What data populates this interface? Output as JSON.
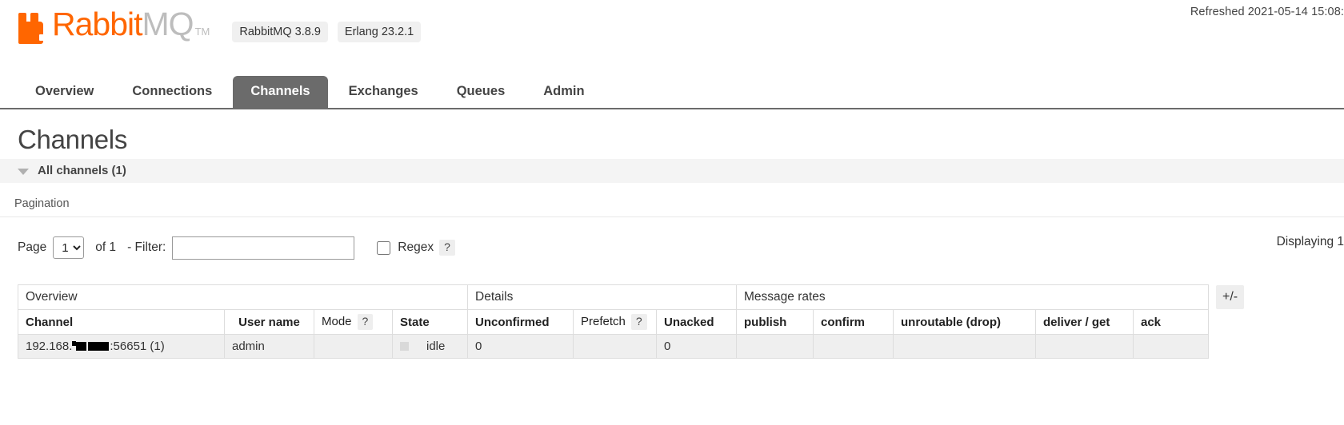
{
  "header": {
    "refreshed": "Refreshed 2021-05-14 15:08:",
    "logo": {
      "name_part1": "Rabbit",
      "name_part2": "MQ",
      "tm": "TM",
      "mark_icon": "rabbit-logo-icon",
      "brand_color": "#ff6600",
      "mq_color": "#bdbdbd"
    },
    "badges": [
      {
        "label": "RabbitMQ 3.8.9"
      },
      {
        "label": "Erlang 23.2.1"
      }
    ]
  },
  "nav": {
    "active": "Channels",
    "tabs": [
      {
        "label": "Overview"
      },
      {
        "label": "Connections"
      },
      {
        "label": "Channels"
      },
      {
        "label": "Exchanges"
      },
      {
        "label": "Queues"
      },
      {
        "label": "Admin"
      }
    ]
  },
  "page": {
    "title": "Channels",
    "section": {
      "label": "All channels (1)",
      "arrow_icon": "chevron-down-icon"
    }
  },
  "pagination": {
    "label": "Pagination",
    "page_word": "Page",
    "page_value": "1",
    "page_options": [
      "1"
    ],
    "of_text": "of 1",
    "filter_label": "- Filter:",
    "filter_value": "",
    "filter_placeholder": "",
    "regex_label": "Regex",
    "regex_checked": false,
    "regex_help": "?",
    "displaying": "Displaying 1"
  },
  "table": {
    "plus_minus": "+/-",
    "groups": [
      {
        "label": "Overview",
        "colspan": 4
      },
      {
        "label": "Details",
        "colspan": 3
      },
      {
        "label": "Message rates",
        "colspan": 5
      }
    ],
    "columns": [
      {
        "label": "Channel",
        "sortable": true,
        "help": null,
        "align": "left"
      },
      {
        "label": "User name",
        "sortable": true,
        "help": null,
        "align": "center"
      },
      {
        "label": "Mode",
        "sortable": false,
        "help": "?",
        "align": "center"
      },
      {
        "label": "State",
        "sortable": true,
        "help": null,
        "align": "center"
      },
      {
        "label": "Unconfirmed",
        "sortable": true,
        "help": null,
        "align": "center"
      },
      {
        "label": "Prefetch",
        "sortable": false,
        "help": "?",
        "align": "center"
      },
      {
        "label": "Unacked",
        "sortable": true,
        "help": null,
        "align": "center"
      },
      {
        "label": "publish",
        "sortable": true,
        "help": null,
        "align": "center"
      },
      {
        "label": "confirm",
        "sortable": true,
        "help": null,
        "align": "center"
      },
      {
        "label": "unroutable (drop)",
        "sortable": true,
        "help": null,
        "align": "center"
      },
      {
        "label": "deliver / get",
        "sortable": true,
        "help": null,
        "align": "center"
      },
      {
        "label": "ack",
        "sortable": true,
        "help": null,
        "align": "center"
      }
    ],
    "rows": [
      {
        "channel_prefix": "192.168.",
        "channel_suffix": ":56651 (1)",
        "channel_redacted": true,
        "user_name": "admin",
        "mode": "",
        "state": "idle",
        "state_icon": "status-square-icon",
        "unconfirmed": "0",
        "prefetch": "",
        "unacked": "0",
        "publish": "",
        "confirm": "",
        "unroutable_drop": "",
        "deliver_get": "",
        "ack": ""
      }
    ]
  }
}
